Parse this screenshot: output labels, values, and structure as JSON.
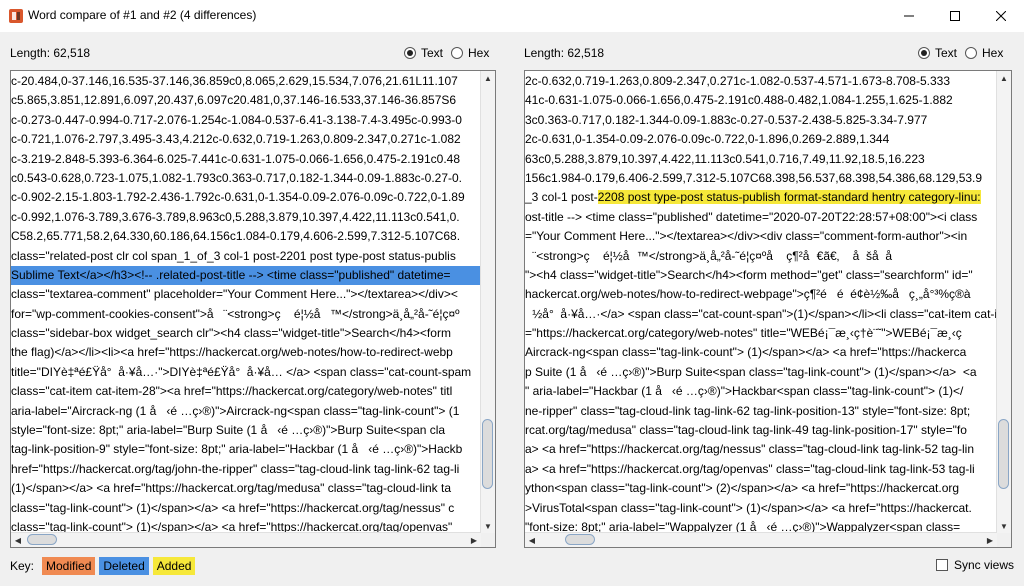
{
  "window": {
    "title": "Word compare of #1 and #2  (4 differences)"
  },
  "left_panel": {
    "length_label": "Length: 62,518",
    "mode": {
      "text": "Text",
      "hex": "Hex",
      "selected": "Text"
    },
    "lines": [
      "c-20.484,0-37.146,16.535-37.146,36.859c0,8.065,2.629,15.534,7.076,21.61L11.107",
      "c5.865,3.851,12.891,6.097,20.437,6.097c20.481,0,37.146-16.533,37.146-36.857S6",
      "c-0.273-0.447-0.994-0.717-2.076-1.254c-1.084-0.537-6.41-3.138-7.4-3.495c-0.993-0",
      "c-0.721,1.076-2.797,3.495-3.43,4.212c-0.632,0.719-1.263,0.809-2.347,0.271c-1.082",
      "c-3.219-2.848-5.393-6.364-6.025-7.441c-0.631-1.075-0.066-1.656,0.475-2.191c0.48",
      "c0.543-0.628,0.723-1.075,1.082-1.793c0.363-0.717,0.182-1.344-0.09-1.883c-0.27-0.",
      "c-0.902-2.15-1.803-1.792-2.436-1.792c-0.631,0-1.354-0.09-2.076-0.09c-0.722,0-1.89",
      "c-0.992,1.076-3.789,3.676-3.789,8.963c0,5.288,3.879,10.397,4.422,11.113c0.541,0.",
      "C58.2,65.771,58.2,64.330,60.186,64.156c1.084-0.179,4.606-2.599,7.312-5.107C68.",
      "class=\"related-post clr col span_1_of_3 col-1 post-2201 post type-post status-publis",
      "Sublime Text</a></h3><!-- .related-post-title --> <time class=\"published\" datetime=",
      "class=\"textarea-comment\" placeholder=\"Your Comment Here...\"></textarea></div><",
      "for=\"wp-comment-cookies-consent\">å¨<strong>ç    é¦½å™</strong>ä¸å„²å-˜é¦ç¤º",
      "class=\"sidebar-box widget_search clr\"><h4 class=\"widget-title\">Search</h4><form",
      "the flag)</a></li><li><a href=\"https://hackercat.org/web-notes/how-to-redirect-webp",
      "title=\"DIYè‡ªé£Ÿå°  å·¥å…·\">DIYè‡ªé£Ÿå°  å·¥å… </a> <span class=\"cat-count-spam",
      "class=\"cat-item cat-item-28\"><a href=\"https://hackercat.org/category/web-notes\" titl",
      "aria-label=\"Aircrack-ng (1 å   ‹é …ç›®)\">Aircrack-ng<span class=\"tag-link-count\"> (1",
      "style=\"font-size: 8pt;\" aria-label=\"Burp Suite (1 å   ‹é …ç›®)\">Burp Suite<span cla",
      "tag-link-position-9\" style=\"font-size: 8pt;\" aria-label=\"Hackbar (1 å   ‹é …ç›®)\">Hackb",
      "href=\"https://hackercat.org/tag/john-the-ripper\" class=\"tag-cloud-link tag-link-62 tag-li",
      "(1)</span></a> <a href=\"https://hackercat.org/tag/medusa\" class=\"tag-cloud-link ta",
      "class=\"tag-link-count\"> (1)</span></a> <a href=\"https://hackercat.org/tag/nessus\" c",
      "class=\"tag-link-count\"> (1)</span></a> <a href=\"https://hackercat.org/tag/openvas\""
    ]
  },
  "right_panel": {
    "length_label": "Length: 62,518",
    "mode": {
      "text": "Text",
      "hex": "Hex",
      "selected": "Text"
    },
    "lines": [
      "2c-0.632,0.719-1.263,0.809-2.347,0.271c-1.082-0.537-4.571-1.673-8.708-5.333",
      "41c-0.631-1.075-0.066-1.656,0.475-2.191c0.488-0.482,1.084-1.255,1.625-1.882",
      "3c0.363-0.717,0.182-1.344-0.09-1.883c-0.27-0.537-2.438-5.825-3.34-7.977",
      "2c-0.631,0-1.354-0.09-2.076-0.09c-0.722,0-1.896,0.269-2.889,1.344",
      "63c0,5.288,3.879,10.397,4.422,11.113c0.541,0.716,7.49,11.92,18.5,16.223",
      "156c1.984-0.179,6.406-2.599,7.312-5.107C68.398,56.537,68.398,54.386,68.129,53.9",
      "_3 col-1 post-|2208 post type-post status-publish format-standard hentry category-linu:",
      "ost-title --> <time class=\"published\" datetime=\"2020-07-20T22:28:57+08:00\"><i class",
      "=\"Your Comment Here...\"></textarea></div><div class=\"comment-form-author\"><in",
      "¨<strong>ç    é¦½å™</strong>ä¸å„²å-˜é¦ç¤ºå    ç¶²å€ã€‚    å  šå  å",
      "\"><h4 class=\"widget-title\">Search</h4><form method=\"get\" class=\"searchform\" id=\"",
      "hackercat.org/web-notes/how-to-redirect-webpage\">ç¶²é   é  é¢è½‰å   ç¸„å°³%ç®à",
      "½å°  å·¥å…·</a> <span class=\"cat-count-span\">(1)</span></li><li class=\"cat-item cat-item-",
      "=\"https://hackercat.org/category/web-notes\" title=\"WEBé¡¯æ¸‹ç­†è¨˜\">WEBé¡¯æ¸‹ç",
      "Aircrack-ng<span class=\"tag-link-count\"> (1)</span></a> <a href=\"https://hackerca",
      "p Suite (1 å   ‹é …ç›®)\">Burp Suite<span class=\"tag-link-count\"> (1)</span></a>  <a",
      "\" aria-label=\"Hackbar (1 å   ‹é …ç›®)\">Hackbar<span class=\"tag-link-count\"> (1)</",
      "ne-ripper\" class=\"tag-cloud-link tag-link-62 tag-link-position-13\" style=\"font-size: 8pt;",
      "rcat.org/tag/medusa\" class=\"tag-cloud-link tag-link-49 tag-link-position-17\" style=\"fo",
      "a> <a href=\"https://hackercat.org/tag/nessus\" class=\"tag-cloud-link tag-link-52 tag-lin",
      "a> <a href=\"https://hackercat.org/tag/openvas\" class=\"tag-cloud-link tag-link-53 tag-li",
      "ython<span class=\"tag-link-count\"> (2)</span></a> <a href=\"https://hackercat.org",
      ">VirusTotal<span class=\"tag-link-count\"> (1)</span></a> <a href=\"https://hackercat.",
      "\"font-size: 8pt;\" aria-label=\"Wappalyzer (1 å   ‹é …ç›®)\">Wappalyzer<span class="
    ]
  },
  "footer": {
    "key_label": "Key:",
    "legend": [
      {
        "label": "Modified",
        "color": "#f08a52"
      },
      {
        "label": "Deleted",
        "color": "#4a90e2"
      },
      {
        "label": "Added",
        "color": "#f6e83a"
      }
    ],
    "sync_label": "Sync views"
  },
  "colors": {
    "deleted_highlight": "#4a90e2",
    "added_highlight": "#f6e83a",
    "app_icon": "#d9572c"
  }
}
